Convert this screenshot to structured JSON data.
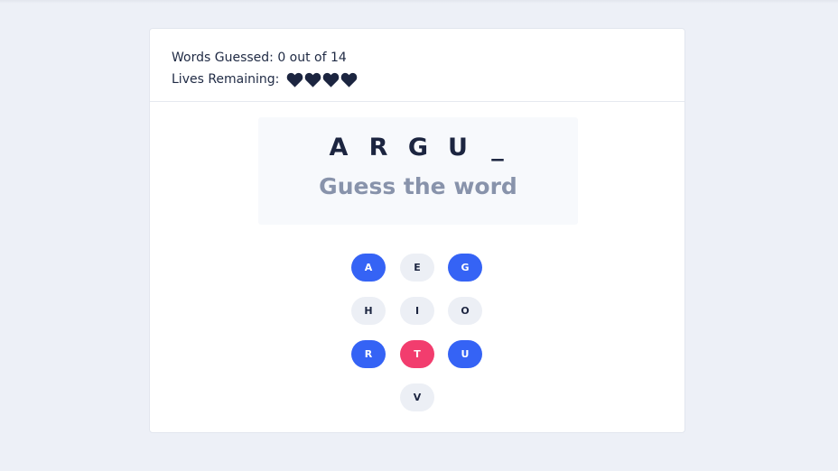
{
  "header": {
    "words_guessed_label": "Words Guessed: 0 out of 14",
    "lives_label": "Lives Remaining:",
    "lives_count": 4,
    "heart_icon": "heart-icon",
    "heart_color": "#1c2540"
  },
  "word": {
    "letters": [
      "A",
      "R",
      "G",
      "U",
      "_"
    ],
    "prompt": "Guess the word"
  },
  "colors": {
    "correct": "#3563f5",
    "wrong": "#f23d6e",
    "unused": "#eceff5"
  },
  "keyboard": {
    "keys": [
      {
        "letter": "A",
        "state": "correct"
      },
      {
        "letter": "E",
        "state": "unused"
      },
      {
        "letter": "G",
        "state": "correct"
      },
      {
        "letter": "H",
        "state": "unused"
      },
      {
        "letter": "I",
        "state": "unused"
      },
      {
        "letter": "O",
        "state": "unused"
      },
      {
        "letter": "R",
        "state": "correct"
      },
      {
        "letter": "T",
        "state": "wrong"
      },
      {
        "letter": "U",
        "state": "correct"
      },
      {
        "letter": "V",
        "state": "unused"
      }
    ]
  }
}
